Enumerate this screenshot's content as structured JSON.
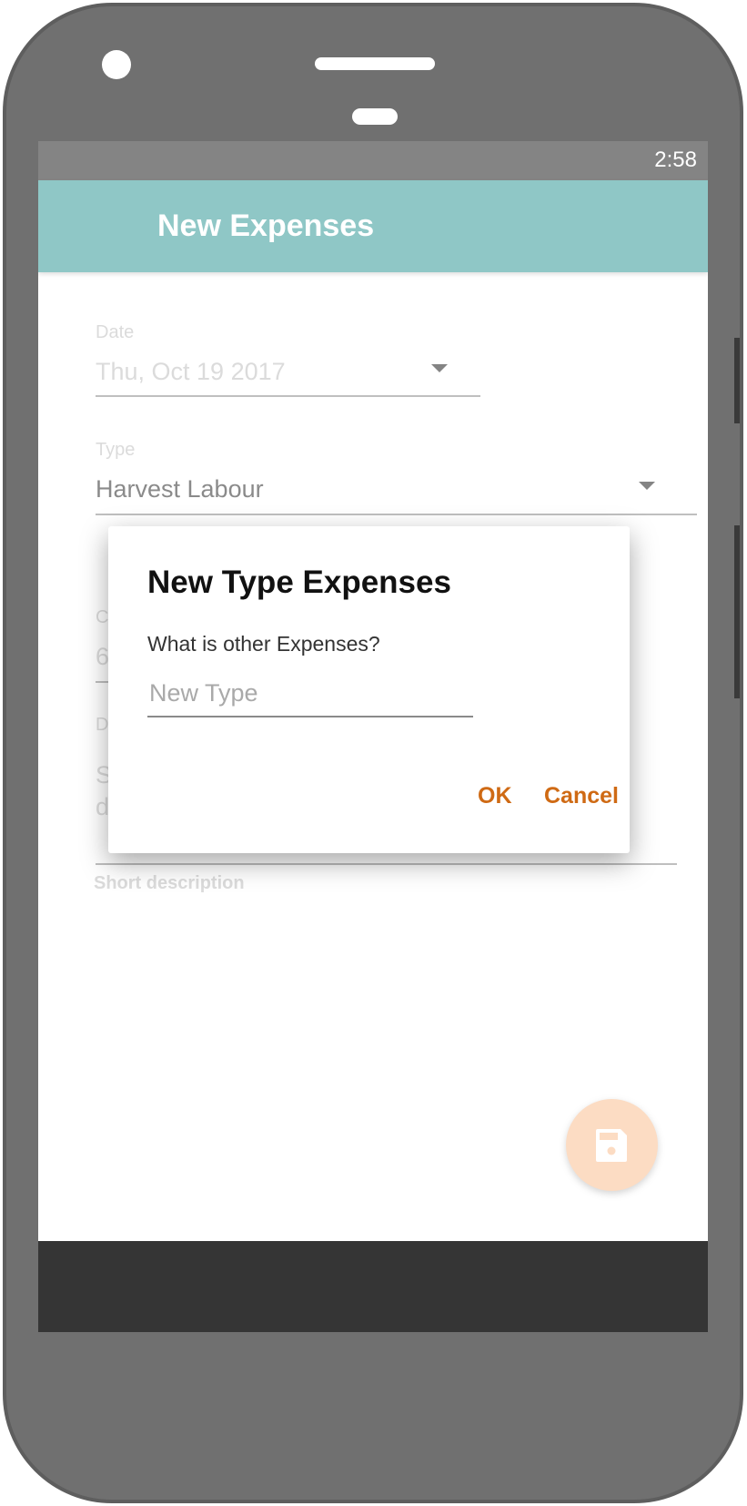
{
  "status_bar": {
    "time": "2:58"
  },
  "app_bar": {
    "title": "New Expenses"
  },
  "form": {
    "date": {
      "label": "Date",
      "value": "Thu, Oct 19 2017"
    },
    "type": {
      "label": "Type",
      "value": "Harvest Labour"
    },
    "cost": {
      "label_partial": "C",
      "value_partial": "6"
    },
    "description": {
      "label_partial": "D",
      "value_partial_line1": "S",
      "value_partial_line2": "d"
    },
    "helper": "Short description"
  },
  "dialog": {
    "title": "New Type Expenses",
    "message": "What is other Expenses?",
    "input_placeholder": "New Type",
    "input_value": "",
    "ok_label": "OK",
    "cancel_label": "Cancel"
  },
  "fab": {
    "icon": "save-icon"
  },
  "colors": {
    "app_bar": "#339a97",
    "accent": "#cf6a14",
    "fab": "#f9bf93",
    "status_bar": "#1f1f1f",
    "nav_bar": "#353535",
    "phone_body": "#707070"
  }
}
